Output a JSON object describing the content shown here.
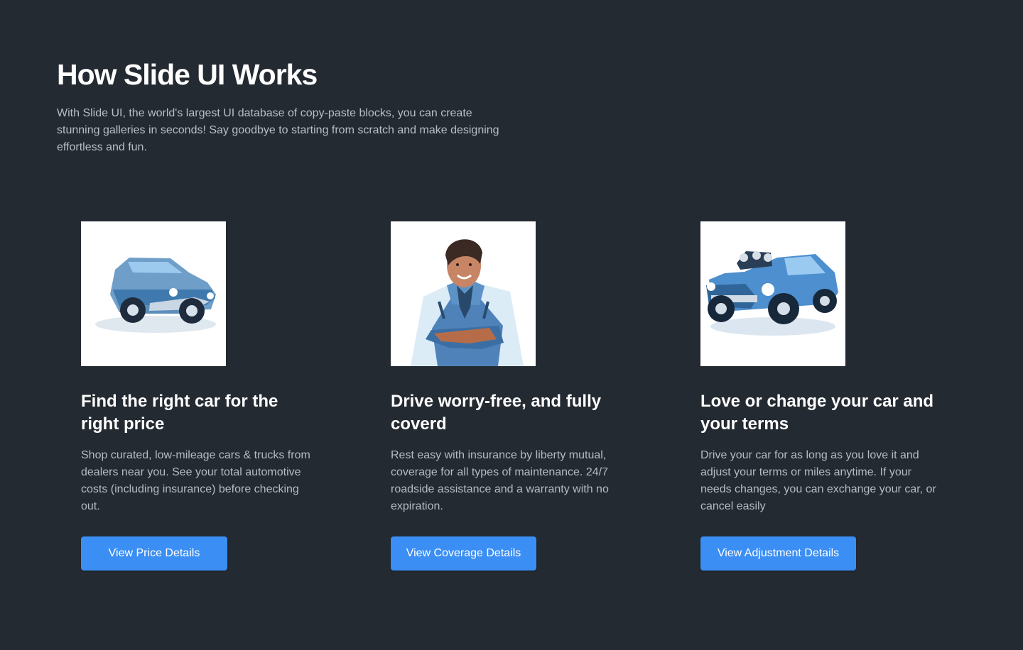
{
  "header": {
    "title": "How Slide UI Works",
    "intro": "With Slide UI, the world's largest UI database of copy-paste blocks, you can create stunning galleries in seconds! Say goodbye to starting from scratch and make designing effortless and fun."
  },
  "cards": [
    {
      "image": "blue-vintage-car-illustration",
      "title": "Find the right car for the right price",
      "text": "Shop curated, low-mileage cars & trucks from dealers near you. See your total automotive costs (including insurance) before checking out.",
      "button": "View Price Details"
    },
    {
      "image": "smiling-man-illustration",
      "title": "Drive worry-free, and fully coverd",
      "text": "Rest easy with insurance by liberty mutual, coverage for all types of maintenance. 24/7 roadside assistance and a warranty with no expiration.",
      "button": "View Coverage Details"
    },
    {
      "image": "blue-hot-rod-car-illustration",
      "title": "Love or change your car and your terms",
      "text": "Drive your car for as long as you love it and adjust your terms or miles anytime. If your needs changes, you can exchange your car, or cancel easily",
      "button": "View Adjustment Details"
    }
  ],
  "colors": {
    "background": "#242a31",
    "accent": "#3b8ef3",
    "body_text": "#b4bbc3"
  }
}
